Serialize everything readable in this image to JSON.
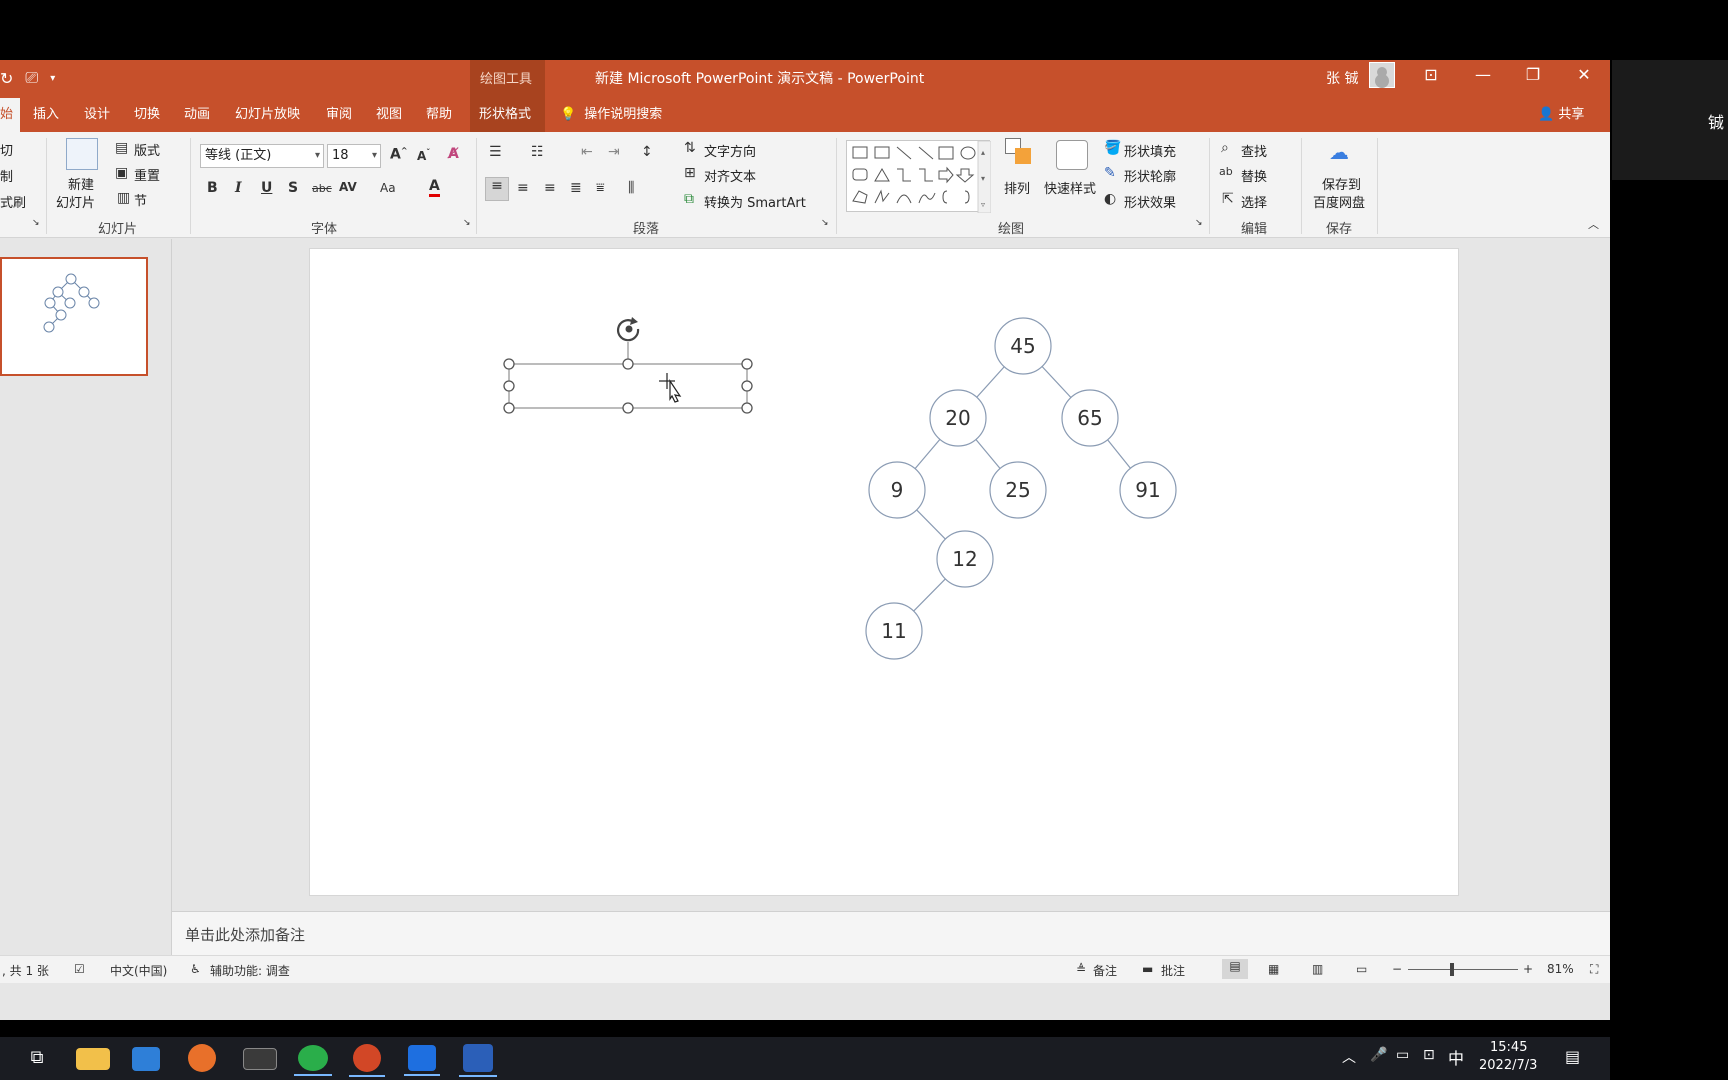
{
  "window": {
    "context_tab_group": "绘图工具",
    "title": "新建 Microsoft PowerPoint 演示文稿 - PowerPoint",
    "user": "张 铖",
    "share": "共享"
  },
  "tabs": [
    "始",
    "插入",
    "设计",
    "切换",
    "动画",
    "幻灯片放映",
    "审阅",
    "视图",
    "帮助",
    "形状格式"
  ],
  "search": {
    "label": "操作说明搜索"
  },
  "ribbon": {
    "clipboard": {
      "cut": "切",
      "copy": "制",
      "painter": "式刷"
    },
    "slides": {
      "group": "幻灯片",
      "new_slide_1": "新建",
      "new_slide_2": "幻灯片",
      "layout": "版式",
      "reset": "重置",
      "section": "节"
    },
    "font": {
      "group": "字体",
      "family": "等线 (正文)",
      "size": "18"
    },
    "paragraph": {
      "group": "段落",
      "text_direction": "文字方向",
      "align_text": "对齐文本",
      "smartart": "转换为 SmartArt"
    },
    "drawing": {
      "group": "绘图",
      "arrange": "排列",
      "quick_styles": "快速样式",
      "fill": "形状填充",
      "outline": "形状轮廓",
      "effects": "形状效果"
    },
    "editing": {
      "group": "编辑",
      "find": "查找",
      "replace": "替换",
      "select": "选择"
    },
    "save": {
      "group": "保存",
      "label_1": "保存到",
      "label_2": "百度网盘"
    }
  },
  "slide": {
    "tree_nodes": [
      {
        "value": "45"
      },
      {
        "value": "20"
      },
      {
        "value": "65"
      },
      {
        "value": "9"
      },
      {
        "value": "25"
      },
      {
        "value": "91"
      },
      {
        "value": "12"
      },
      {
        "value": "11"
      }
    ]
  },
  "notes": {
    "placeholder": "单击此处添加备注"
  },
  "status": {
    "slide_count": ", 共 1 张",
    "language": "中文(中国)",
    "accessibility": "辅助功能: 调查",
    "notes": "备注",
    "comments": "批注",
    "zoom": "81%"
  },
  "taskbar": {
    "time": "15:45",
    "date": "2022/7/3",
    "ime": "中"
  },
  "side_char": "铖",
  "colors": {
    "accent": "#c6502b",
    "taskbar": "#1a1c22"
  }
}
